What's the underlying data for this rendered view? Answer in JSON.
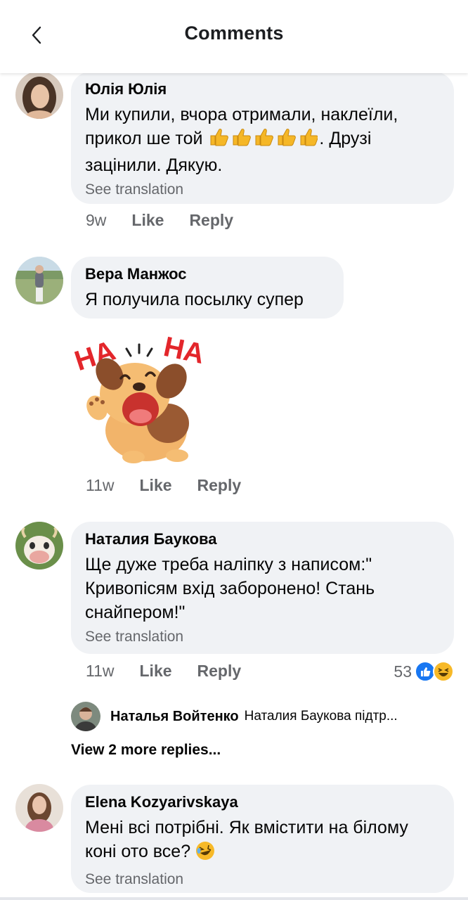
{
  "header": {
    "title": "Comments"
  },
  "comments": [
    {
      "author": "Юлія Юлія",
      "text_part1": "Ми купили, вчора отримали, наклеїли, прикол ше той",
      "text_part2": ". Друзі зацінили. Дякую.",
      "see_translation": "See translation",
      "time": "9w",
      "like": "Like",
      "reply": "Reply"
    },
    {
      "author": "Вера Манжос",
      "text": "Я получила посылку супер",
      "sticker": {
        "name": "haha-dog-sticker",
        "left_text": "HA",
        "right_text": "HA"
      },
      "time": "11w",
      "like": "Like",
      "reply": "Reply"
    },
    {
      "author": "Наталия Баукова",
      "text": "Ще дуже треба наліпку з написом:\" Кривопісям вхід заборонено! Стань снайпером!\"",
      "see_translation": "See translation",
      "time": "11w",
      "like": "Like",
      "reply": "Reply",
      "reaction_count": "53",
      "reply_preview": {
        "author": "Наталья Войтенко",
        "text": "Наталия Баукова підтр..."
      },
      "view_more": "View 2 more replies..."
    },
    {
      "author": "Elena Kozyarivskaya",
      "text": "Мені всі потрібні. Як вмістити на білому коні ото все?",
      "see_translation": "See translation"
    }
  ],
  "colors": {
    "bubble": "#f0f2f5",
    "meta": "#65676b",
    "like_blue": "#1877f2",
    "haha_yellow": "#f7b928"
  },
  "icons": [
    "back-arrow-icon",
    "thumbs-up-emoji-icon",
    "like-reaction-icon",
    "haha-reaction-icon",
    "rolling-laugh-emoji-icon"
  ]
}
